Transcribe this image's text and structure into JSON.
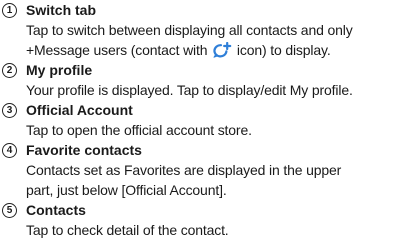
{
  "items": [
    {
      "number": "1",
      "title": "Switch tab",
      "lines": [
        "Tap to switch between displaying all contacts and only",
        "+Message users (contact with",
        "icon) to display."
      ],
      "icon": "plus-message-icon",
      "icon_color": "#2f7fd8"
    },
    {
      "number": "2",
      "title": "My profile",
      "lines": [
        "Your profile is displayed. Tap to display/edit My profile."
      ]
    },
    {
      "number": "3",
      "title": "Official Account",
      "lines": [
        "Tap to open the official account store."
      ]
    },
    {
      "number": "4",
      "title": "Favorite contacts",
      "lines": [
        "Contacts set as Favorites are displayed in the upper",
        "part, just below [Official Account]."
      ]
    },
    {
      "number": "5",
      "title": "Contacts",
      "lines": [
        "Tap to check detail of the contact."
      ]
    }
  ]
}
